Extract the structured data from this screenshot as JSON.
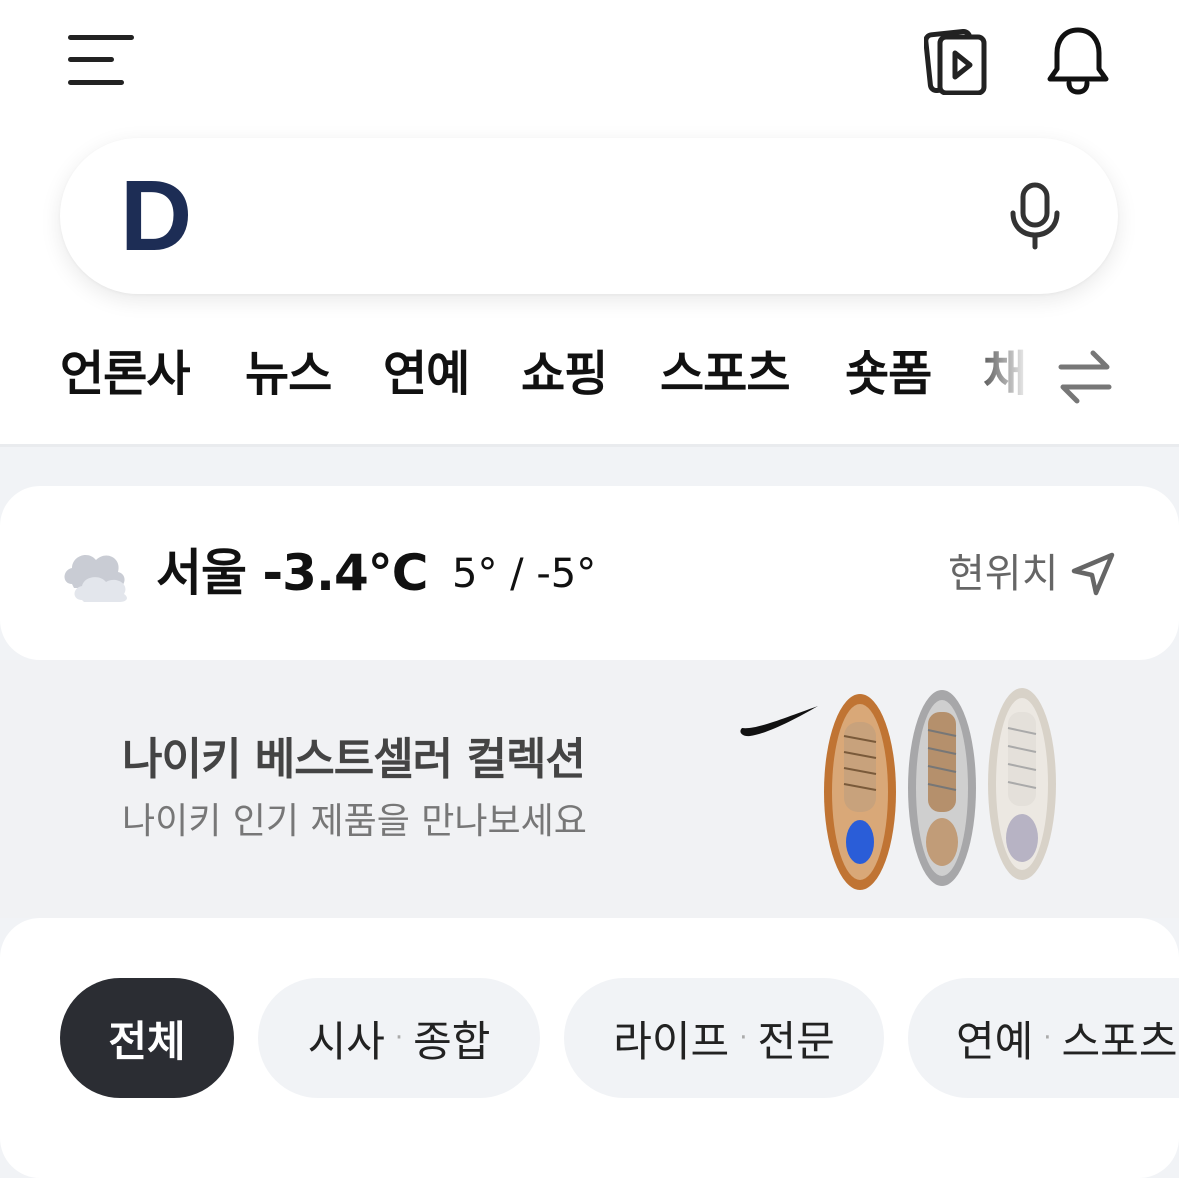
{
  "header": {
    "menu_icon": "hamburger-menu-icon",
    "video_icon": "video-stack-icon",
    "bell_icon": "bell-icon"
  },
  "search": {
    "logo": "D",
    "placeholder": "",
    "mic_icon": "microphone-icon"
  },
  "tabs": {
    "items": [
      "언론사",
      "뉴스",
      "연예",
      "쇼핑",
      "스포츠",
      "숏폼",
      "채"
    ],
    "active_index": 0,
    "swap_icon": "swap-arrows-icon"
  },
  "weather": {
    "icon": "cloud-icon",
    "city_temp": "서울 -3.4°C",
    "range": "5° / -5°",
    "location_label": "현위치",
    "location_icon": "location-arrow-icon"
  },
  "banner": {
    "title": "나이키 베스트셀러 컬렉션",
    "subtitle": "나이키 인기 제품을 만나보세요",
    "image": "nike-sneakers-image"
  },
  "categories": {
    "chips": [
      {
        "label": "전체",
        "active": true
      },
      {
        "left": "시사",
        "right": "종합"
      },
      {
        "left": "라이프",
        "right": "전문"
      },
      {
        "left": "연예",
        "right": "스포츠"
      }
    ],
    "separator": "·"
  },
  "colors": {
    "logo": "#1d2d55",
    "active_chip": "#2b2d33",
    "page_bg": "#f1f3f6"
  }
}
